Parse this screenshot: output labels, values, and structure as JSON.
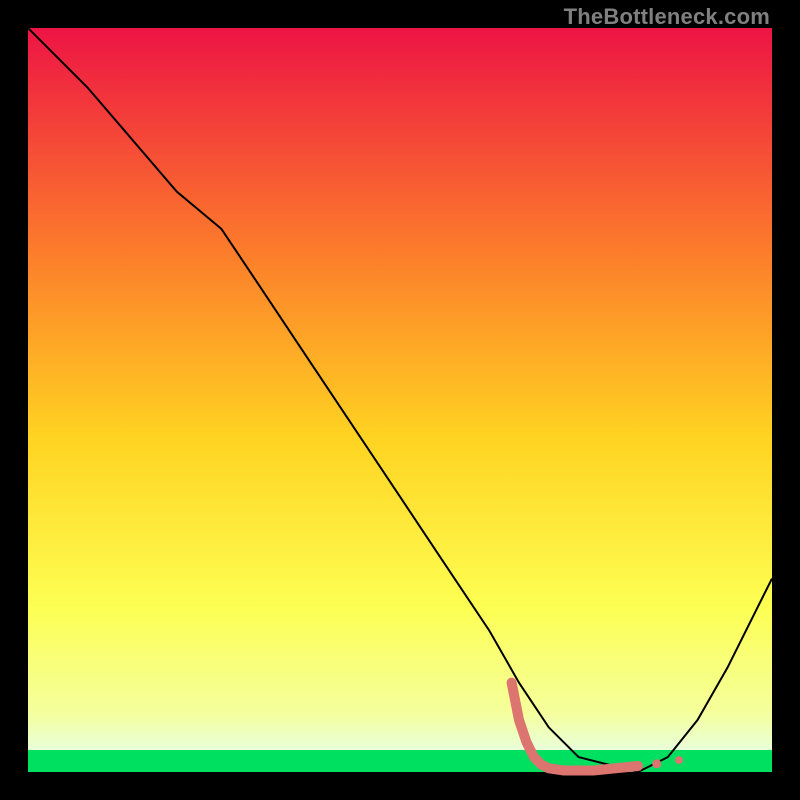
{
  "watermark": {
    "text": "TheBottleneck.com"
  },
  "chart_data": {
    "type": "line",
    "title": "",
    "xlabel": "",
    "ylabel": "",
    "xlim": [
      0,
      100
    ],
    "ylim": [
      0,
      100
    ],
    "grid": false,
    "legend": false,
    "bg_gradient_stops": [
      {
        "pos": 0,
        "color": "#ED1444"
      },
      {
        "pos": 30,
        "color": "#FC7C2B"
      },
      {
        "pos": 55,
        "color": "#FFD321"
      },
      {
        "pos": 78,
        "color": "#FDFF53"
      },
      {
        "pos": 92,
        "color": "#F4FF9C"
      },
      {
        "pos": 97,
        "color": "#E9FFD9"
      },
      {
        "pos": 100,
        "color": "#00E060"
      }
    ],
    "series": [
      {
        "name": "bottleneck-curve",
        "color": "#000000",
        "stroke_width": 2,
        "x": [
          0,
          8,
          14,
          20,
          26,
          32,
          38,
          44,
          50,
          56,
          62,
          66,
          70,
          74,
          78,
          82,
          86,
          90,
          94,
          98,
          100
        ],
        "y": [
          100,
          92,
          85,
          78,
          73,
          64,
          55,
          46,
          37,
          28,
          19,
          12,
          6,
          2,
          1,
          0,
          2,
          7,
          14,
          22,
          26
        ]
      },
      {
        "name": "optimal-zone-marker",
        "color": "#DC7470",
        "stroke_width": 10,
        "x": [
          65,
          66,
          67,
          68,
          69,
          70,
          72,
          74,
          76,
          78,
          80,
          82
        ],
        "y": [
          12,
          7,
          4,
          2,
          1,
          0.5,
          0.2,
          0.2,
          0.2,
          0.4,
          0.6,
          0.8
        ]
      }
    ]
  }
}
